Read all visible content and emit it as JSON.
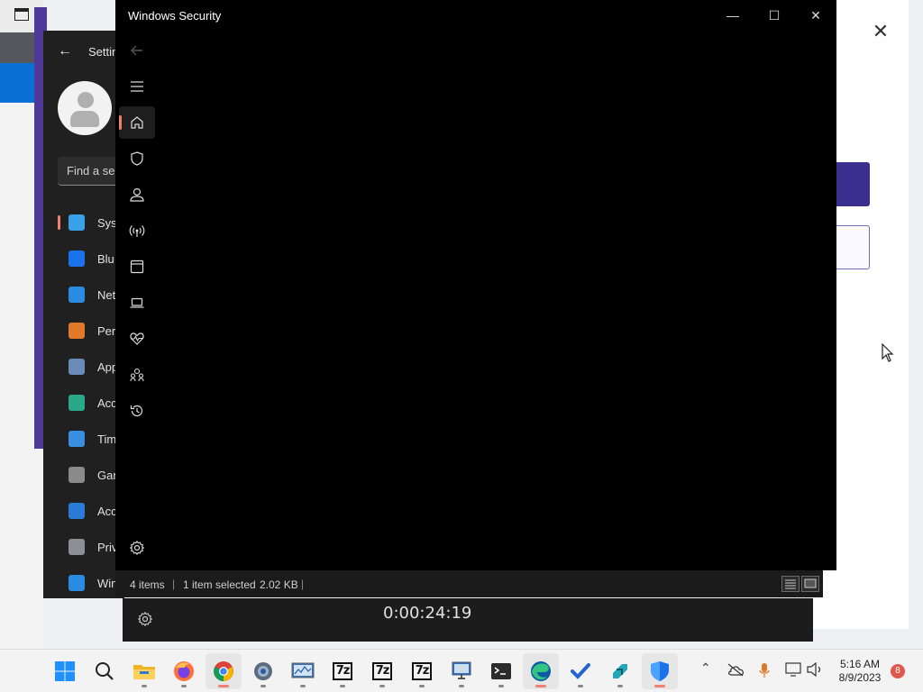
{
  "window": {
    "title": "Windows Security",
    "minimize_icon": "minimize-icon",
    "maximize_icon": "maximize-icon",
    "close_icon": "close-icon"
  },
  "security_sidebar": [
    {
      "name": "back-icon",
      "active": false
    },
    {
      "name": "menu-icon",
      "active": false
    },
    {
      "name": "home-icon",
      "active": true
    },
    {
      "name": "shield-icon",
      "active": false
    },
    {
      "name": "account-icon",
      "active": false
    },
    {
      "name": "network-icon",
      "active": false
    },
    {
      "name": "app-browser-icon",
      "active": false
    },
    {
      "name": "device-security-icon",
      "active": false
    },
    {
      "name": "health-icon",
      "active": false
    },
    {
      "name": "family-icon",
      "active": false
    },
    {
      "name": "history-icon",
      "active": false
    },
    {
      "name": "settings-icon",
      "active": false
    }
  ],
  "settings_app": {
    "title": "Settin",
    "search_placeholder": "Find a se",
    "nav": [
      {
        "label": "Sys",
        "icon": "system-icon",
        "color": "#3aa0e8",
        "active": true
      },
      {
        "label": "Blu",
        "icon": "bluetooth-icon",
        "color": "#1a73e8",
        "active": false
      },
      {
        "label": "Net",
        "icon": "wifi-icon",
        "color": "#2a8be0",
        "active": false
      },
      {
        "label": "Per",
        "icon": "brush-icon",
        "color": "#e07a2a",
        "active": false
      },
      {
        "label": "App",
        "icon": "apps-icon",
        "color": "#6a8ab8",
        "active": false
      },
      {
        "label": "Acc",
        "icon": "accounts-icon",
        "color": "#2aa88a",
        "active": false
      },
      {
        "label": "Tim",
        "icon": "time-icon",
        "color": "#3a8ee0",
        "active": false
      },
      {
        "label": "Gar",
        "icon": "gaming-icon",
        "color": "#8a8a8a",
        "active": false
      },
      {
        "label": "Acc",
        "icon": "accessibility-icon",
        "color": "#2a7ad8",
        "active": false
      },
      {
        "label": "Priv",
        "icon": "privacy-icon",
        "color": "#8a8f96",
        "active": false
      },
      {
        "label": "Win",
        "icon": "update-icon",
        "color": "#2a8be0",
        "active": false
      }
    ]
  },
  "explorer_status": {
    "items": "4 items",
    "selected": "1 item selected",
    "size": "2.02 KB"
  },
  "recorder": {
    "elapsed": "0:00:24:19"
  },
  "taskbar": {
    "apps": [
      {
        "name": "start-button",
        "icon": "windows-icon"
      },
      {
        "name": "search-button",
        "icon": "search-icon"
      },
      {
        "name": "file-explorer-button",
        "icon": "folder-icon"
      },
      {
        "name": "firefox-button",
        "icon": "firefox-icon"
      },
      {
        "name": "chrome-button",
        "icon": "chrome-icon"
      },
      {
        "name": "settings-taskbar-button",
        "icon": "gear-icon"
      },
      {
        "name": "resource-monitor-button",
        "icon": "monitor-icon"
      },
      {
        "name": "7zip-button-1",
        "icon": "7zip-icon",
        "text": "7z"
      },
      {
        "name": "7zip-button-2",
        "icon": "7zip-icon",
        "text": "7z"
      },
      {
        "name": "7zip-button-3",
        "icon": "7zip-icon",
        "text": "7z"
      },
      {
        "name": "remote-desktop-button",
        "icon": "remote-desktop-icon"
      },
      {
        "name": "terminal-button",
        "icon": "terminal-icon"
      },
      {
        "name": "edge-button",
        "icon": "edge-icon"
      },
      {
        "name": "todo-button",
        "icon": "checkmark-icon"
      },
      {
        "name": "app-button",
        "icon": "app-icon"
      },
      {
        "name": "windows-security-button",
        "icon": "shield-icon"
      }
    ],
    "time": "5:16 AM",
    "date": "8/9/2023",
    "notifications": "8"
  },
  "colors": {
    "accent": "#f08070",
    "security_bg": "#000000",
    "purple": "#3b2f8f"
  }
}
